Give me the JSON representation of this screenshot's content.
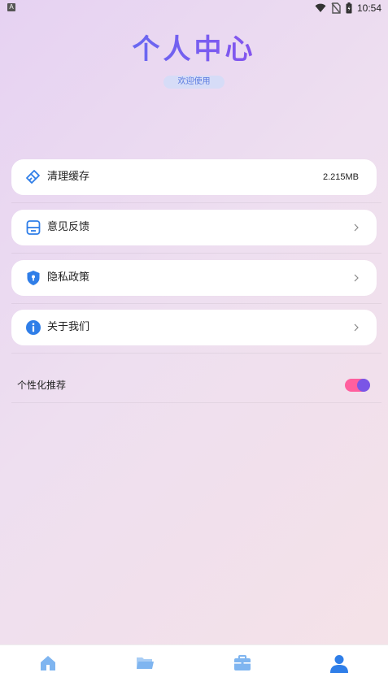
{
  "status_bar": {
    "time": "10:54",
    "app_badge": "A"
  },
  "header": {
    "title": "个人中心",
    "subtitle": "欢迎使用"
  },
  "menu": {
    "items": [
      {
        "label": "清理缓存",
        "value": "2.215MB",
        "icon": "broom-icon"
      },
      {
        "label": "意见反馈",
        "icon": "feedback-box-icon"
      },
      {
        "label": "隐私政策",
        "icon": "shield-lock-icon"
      },
      {
        "label": "关于我们",
        "icon": "info-circle-icon"
      }
    ]
  },
  "personalized": {
    "label": "个性化推荐",
    "enabled": true
  },
  "bottom_nav": {
    "items": [
      {
        "icon": "home-icon",
        "active": false
      },
      {
        "icon": "folder-icon",
        "active": false
      },
      {
        "icon": "briefcase-icon",
        "active": false
      },
      {
        "icon": "user-icon",
        "active": true
      }
    ]
  },
  "colors": {
    "accent_blue": "#2f7ee8",
    "nav_inactive": "#7fb5f0",
    "toggle_track": "#ff5f9e",
    "toggle_knob": "#7a55e6",
    "subtitle_bg": "#d6dcf7"
  }
}
